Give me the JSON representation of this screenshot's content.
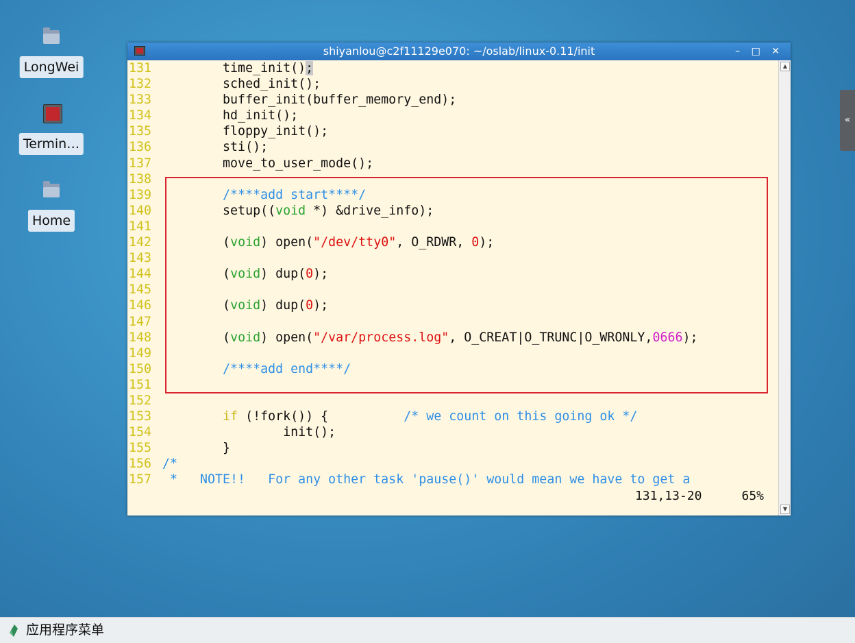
{
  "desktop": {
    "icons": [
      {
        "label": "LongWei",
        "icon": "folder-icon"
      },
      {
        "label": "Termin…",
        "icon": "terminal-icon"
      },
      {
        "label": "Home",
        "icon": "home-folder-icon"
      }
    ]
  },
  "window": {
    "title": "shiyanlou@c2f11129e070: ~/oslab/linux-0.11/init",
    "controls": {
      "minimize": "–",
      "maximize": "□",
      "close": "✕"
    }
  },
  "editor": {
    "lines": [
      {
        "n": "131",
        "text": "        time_init();"
      },
      {
        "n": "132",
        "text": "        sched_init();"
      },
      {
        "n": "133",
        "text": "        buffer_init(buffer_memory_end);"
      },
      {
        "n": "134",
        "text": "        hd_init();"
      },
      {
        "n": "135",
        "text": "        floppy_init();"
      },
      {
        "n": "136",
        "text": "        sti();"
      },
      {
        "n": "137",
        "text": "        move_to_user_mode();"
      },
      {
        "n": "138",
        "text": ""
      },
      {
        "n": "139",
        "text": "        /****add start****/"
      },
      {
        "n": "140",
        "text": "        setup((void *) &drive_info);"
      },
      {
        "n": "141",
        "text": ""
      },
      {
        "n": "142",
        "text": "        (void) open(\"/dev/tty0\", O_RDWR, 0);"
      },
      {
        "n": "143",
        "text": ""
      },
      {
        "n": "144",
        "text": "        (void) dup(0);"
      },
      {
        "n": "145",
        "text": ""
      },
      {
        "n": "146",
        "text": "        (void) dup(0);"
      },
      {
        "n": "147",
        "text": ""
      },
      {
        "n": "148",
        "text": "        (void) open(\"/var/process.log\", O_CREAT|O_TRUNC|O_WRONLY,0666);"
      },
      {
        "n": "149",
        "text": ""
      },
      {
        "n": "150",
        "text": "        /****add end****/"
      },
      {
        "n": "151",
        "text": ""
      },
      {
        "n": "152",
        "text": ""
      },
      {
        "n": "153",
        "text": "        if (!fork()) {          /* we count on this going ok */"
      },
      {
        "n": "154",
        "text": "                init();"
      },
      {
        "n": "155",
        "text": "        }"
      },
      {
        "n": "156",
        "text": "/*"
      },
      {
        "n": "157",
        "text": " *   NOTE!!   For any other task 'pause()' would mean we have to get a"
      }
    ],
    "ruler_position": "131,13-20",
    "ruler_percent": "65%"
  },
  "side_tab": {
    "label": "«"
  },
  "taskbar": {
    "menu_label": "应用程序菜单"
  },
  "colors": {
    "highlight_box": "#d9232e",
    "editor_bg": "#fff7e0",
    "line_number": "#d0c21a",
    "comment": "#2d8fe6",
    "type": "#27a32f",
    "string": "#dd1111"
  }
}
